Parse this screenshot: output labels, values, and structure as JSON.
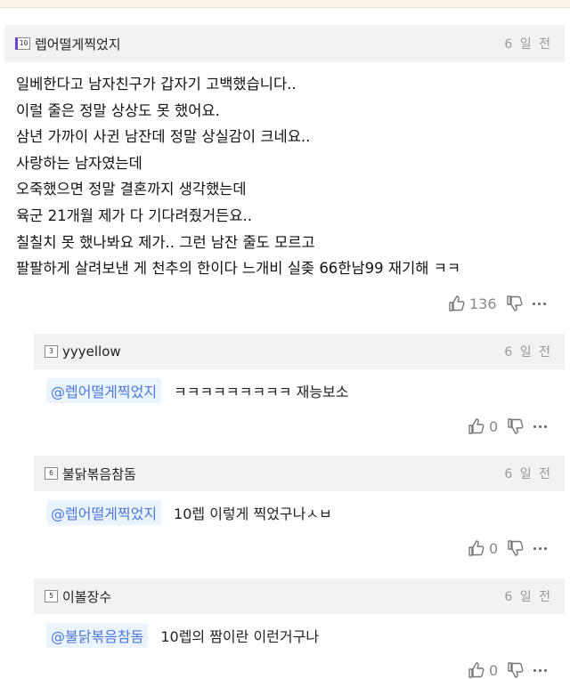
{
  "main_comment": {
    "level": "10",
    "username": "렙어떨게찍었지",
    "date": "6 일 전",
    "lines": [
      "일베한다고 남자친구가 갑자기 고백했습니다..",
      "이럴 줄은 정말 상상도 못 했어요.",
      "삼년 가까이 사귄 남잔데 정말 상실감이 크네요..",
      "사랑하는 남자였는데",
      "오죽했으면 정말 결혼까지 생각했는데",
      "육군 21개월 제가 다 기다려줬거든요..",
      "칠칠치 못 했나봐요 제가.. 그런 남잔 줄도 모르고",
      "팔팔하게 살려보낸 게 천추의 한이다 느개비 실좆 66한남99 재기해 ㅋㅋ"
    ],
    "likes": "136",
    "like_icon": "thumbs-up-icon",
    "dislike_icon": "thumbs-down-icon",
    "more_icon": "more-icon"
  },
  "replies": [
    {
      "level": "3",
      "username": "yyyellow",
      "date": "6 일 전",
      "mention": "@렙어떨게찍었지",
      "text": "ㅋㅋㅋㅋㅋㅋㅋㅋㅋ 재능보소",
      "likes": "0"
    },
    {
      "level": "6",
      "username": "불닭볶음참돔",
      "date": "6 일 전",
      "mention": "@렙어떨게찍었지",
      "text": "10렙 이렇게 찍었구나ㅅㅂ",
      "likes": "0"
    },
    {
      "level": "5",
      "username": "이볼장수",
      "date": "6 일 전",
      "mention": "@불닭볶음참돔",
      "text": "10렙의 짬이란 이런거구나",
      "likes": "0"
    }
  ]
}
